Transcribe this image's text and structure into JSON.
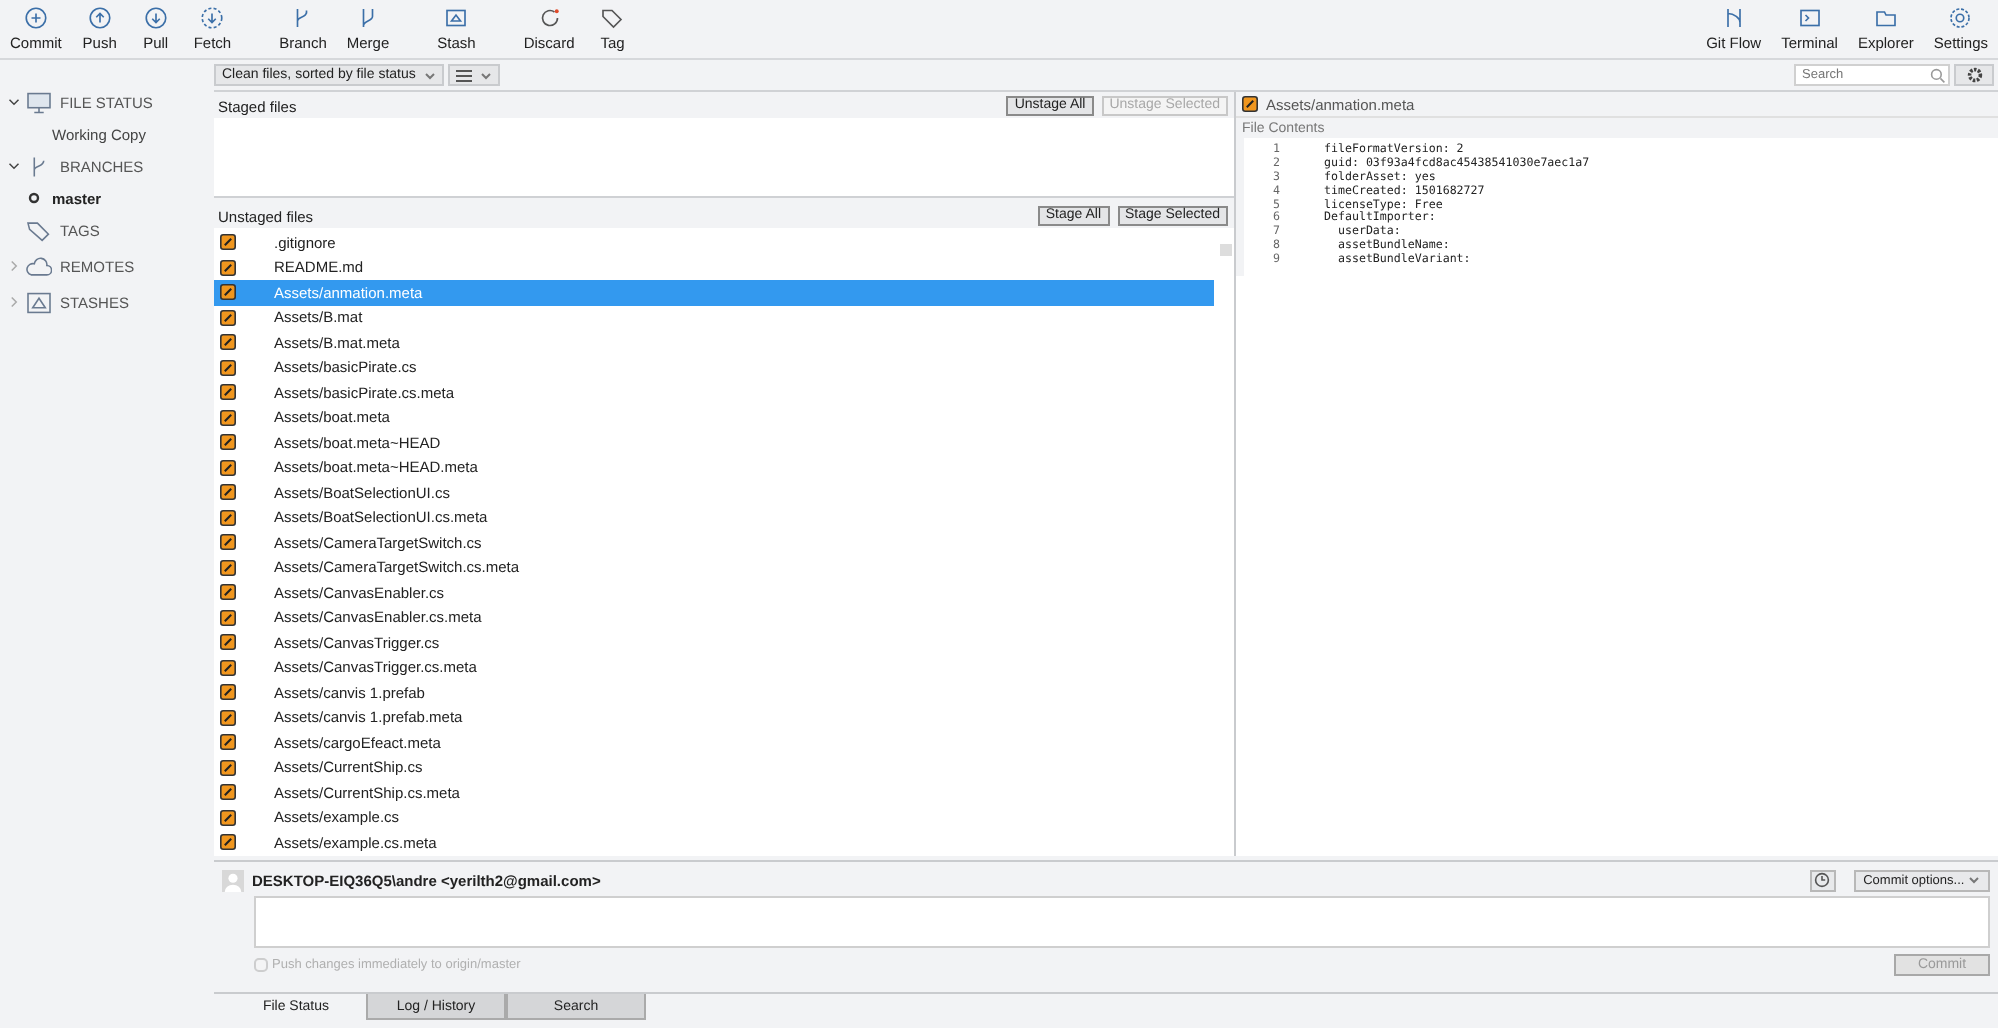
{
  "toolbar": {
    "left": [
      {
        "label": "Commit"
      },
      {
        "label": "Push"
      },
      {
        "label": "Pull"
      },
      {
        "label": "Fetch"
      },
      {
        "label": "Branch"
      },
      {
        "label": "Merge"
      },
      {
        "label": "Stash"
      },
      {
        "label": "Discard"
      },
      {
        "label": "Tag"
      }
    ],
    "right": [
      {
        "label": "Git Flow"
      },
      {
        "label": "Terminal"
      },
      {
        "label": "Explorer"
      },
      {
        "label": "Settings"
      }
    ]
  },
  "sidebar": [
    {
      "label": "FILE STATUS",
      "expanded": true,
      "children": [
        {
          "label": "Working Copy",
          "current": false
        }
      ]
    },
    {
      "label": "BRANCHES",
      "expanded": true,
      "children": [
        {
          "label": "master",
          "current": true
        }
      ]
    },
    {
      "label": "TAGS"
    },
    {
      "label": "REMOTES",
      "expanded": false
    },
    {
      "label": "STASHES",
      "expanded": false
    }
  ],
  "filter": {
    "sort": "Clean files, sorted by file status"
  },
  "search": {
    "placeholder": "Search"
  },
  "staged": {
    "title": "Staged files",
    "buttons": [
      {
        "label": "Unstage All",
        "disabled": false
      },
      {
        "label": "Unstage Selected",
        "disabled": true
      }
    ]
  },
  "unstaged": {
    "title": "Unstaged files",
    "buttons": [
      {
        "label": "Stage All",
        "disabled": false
      },
      {
        "label": "Stage Selected",
        "disabled": false
      }
    ],
    "files": [
      {
        "name": ".gitignore",
        "selected": false
      },
      {
        "name": "README.md",
        "selected": false
      },
      {
        "name": "Assets/anmation.meta",
        "selected": true
      },
      {
        "name": "Assets/B.mat",
        "selected": false
      },
      {
        "name": "Assets/B.mat.meta",
        "selected": false
      },
      {
        "name": "Assets/basicPirate.cs",
        "selected": false
      },
      {
        "name": "Assets/basicPirate.cs.meta",
        "selected": false
      },
      {
        "name": "Assets/boat.meta",
        "selected": false
      },
      {
        "name": "Assets/boat.meta~HEAD",
        "selected": false
      },
      {
        "name": "Assets/boat.meta~HEAD.meta",
        "selected": false
      },
      {
        "name": "Assets/BoatSelectionUI.cs",
        "selected": false
      },
      {
        "name": "Assets/BoatSelectionUI.cs.meta",
        "selected": false
      },
      {
        "name": "Assets/CameraTargetSwitch.cs",
        "selected": false
      },
      {
        "name": "Assets/CameraTargetSwitch.cs.meta",
        "selected": false
      },
      {
        "name": "Assets/CanvasEnabler.cs",
        "selected": false
      },
      {
        "name": "Assets/CanvasEnabler.cs.meta",
        "selected": false
      },
      {
        "name": "Assets/CanvasTrigger.cs",
        "selected": false
      },
      {
        "name": "Assets/CanvasTrigger.cs.meta",
        "selected": false
      },
      {
        "name": "Assets/canvis 1.prefab",
        "selected": false
      },
      {
        "name": "Assets/canvis 1.prefab.meta",
        "selected": false
      },
      {
        "name": "Assets/cargoEfeact.meta",
        "selected": false
      },
      {
        "name": "Assets/CurrentShip.cs",
        "selected": false
      },
      {
        "name": "Assets/CurrentShip.cs.meta",
        "selected": false
      },
      {
        "name": "Assets/example.cs",
        "selected": false
      },
      {
        "name": "Assets/example.cs.meta",
        "selected": false
      }
    ]
  },
  "preview": {
    "file": "Assets/anmation.meta",
    "section": "File Contents",
    "lines": [
      {
        "number": "1",
        "text": "fileFormatVersion: 2"
      },
      {
        "number": "2",
        "text": "guid: 03f93a4fcd8ac45438541030e7aec1a7"
      },
      {
        "number": "3",
        "text": "folderAsset: yes"
      },
      {
        "number": "4",
        "text": "timeCreated: 1501682727"
      },
      {
        "number": "5",
        "text": "licenseType: Free"
      },
      {
        "number": "6",
        "text": "DefaultImporter:"
      },
      {
        "number": "7",
        "text": "  userData:"
      },
      {
        "number": "8",
        "text": "  assetBundleName:"
      },
      {
        "number": "9",
        "text": "  assetBundleVariant:"
      }
    ]
  },
  "commit": {
    "author": "DESKTOP-EIQ36Q5\\andre <yerilth2@gmail.com>",
    "options": "Commit options...",
    "push_option": {
      "label": "Push changes immediately to origin/master",
      "checked": false,
      "disabled": true
    },
    "button": {
      "label": "Commit",
      "disabled": true
    }
  },
  "tabs": [
    {
      "label": "File Status",
      "selected": true
    },
    {
      "label": "Log / History",
      "selected": false
    },
    {
      "label": "Search",
      "selected": false
    }
  ]
}
